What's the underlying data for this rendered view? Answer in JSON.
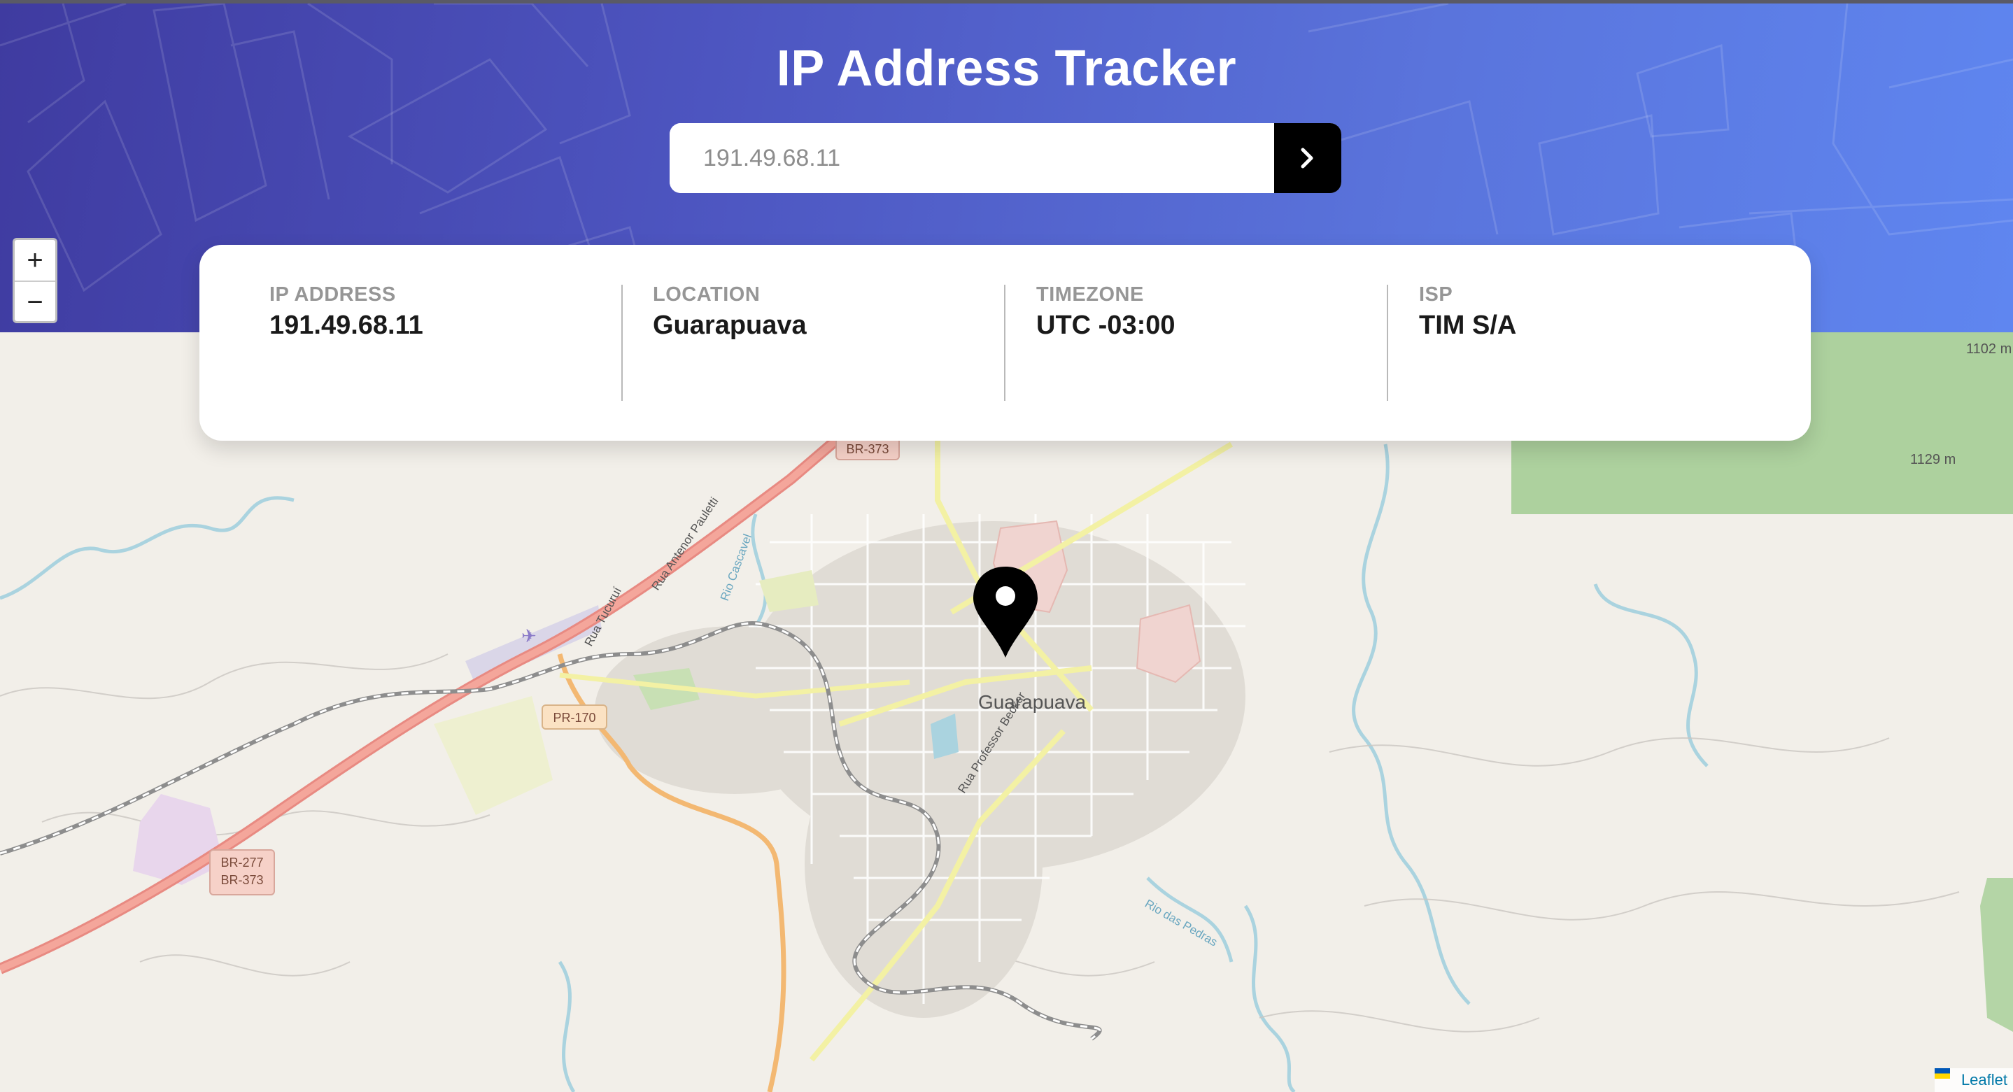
{
  "app": {
    "title": "IP Address Tracker"
  },
  "search": {
    "placeholder": "191.49.68.11",
    "value": ""
  },
  "info": {
    "ip_label": "IP ADDRESS",
    "ip_value": "191.49.68.11",
    "location_label": "LOCATION",
    "location_value": "Guarapuava",
    "timezone_label": "TIMEZONE",
    "timezone_value": "UTC -03:00",
    "isp_label": "ISP",
    "isp_value": "TIM S/A"
  },
  "map": {
    "zoom_in": "+",
    "zoom_out": "−",
    "city_label": "Guarapuava",
    "road_labels": [
      "BR-373",
      "PR-170",
      "BR-277",
      "BR-373",
      "Rua Antenor Pauletti",
      "Rua Tucuruí",
      "Rua Professor Becker",
      "Rio Cascavel",
      "Rio das Pedras"
    ],
    "elevations": [
      "1102 m",
      "1129 m"
    ],
    "attribution": "Leaflet"
  },
  "colors": {
    "header_start": "#3f3ba0",
    "header_end": "#5f86f0",
    "button": "#000000",
    "accent_link": "#0078a8"
  }
}
